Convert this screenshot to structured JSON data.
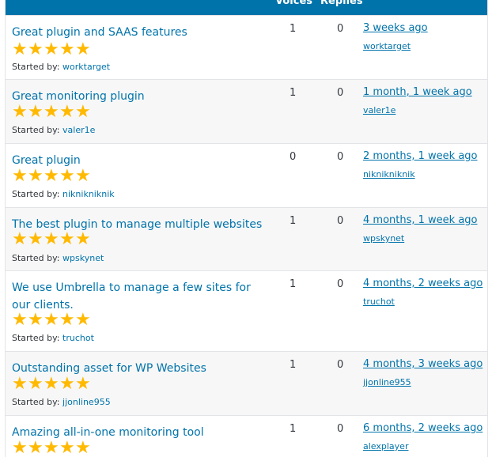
{
  "header": {
    "voices": "Voices",
    "replies": "Replies"
  },
  "rating_color": "#ffb900",
  "link_color": "#0073aa",
  "header_color": "#0073aa",
  "topics": [
    {
      "title": "Great plugin and SAAS features",
      "rating": 5,
      "started_label": "Started by:",
      "author": "worktarget",
      "voices": "1",
      "replies": "0",
      "freshness": "3 weeks ago",
      "last_user": "worktarget"
    },
    {
      "title": "Great monitoring plugin",
      "rating": 5,
      "started_label": "Started by:",
      "author": "valer1e",
      "voices": "1",
      "replies": "0",
      "freshness": "1 month, 1 week ago",
      "last_user": "valer1e"
    },
    {
      "title": "Great plugin",
      "rating": 5,
      "started_label": "Started by:",
      "author": "niknikniknik",
      "voices": "0",
      "replies": "0",
      "freshness": "2 months, 1 week ago",
      "last_user": "niknikniknik"
    },
    {
      "title": "The best plugin to manage multiple websites",
      "rating": 5,
      "started_label": "Started by:",
      "author": "wpskynet",
      "voices": "1",
      "replies": "0",
      "freshness": "4 months, 1 week ago",
      "last_user": "wpskynet"
    },
    {
      "title": "We use Umbrella to manage a few sites for our clients.",
      "rating": 5,
      "started_label": "Started by:",
      "author": "truchot",
      "voices": "1",
      "replies": "0",
      "freshness": "4 months, 2 weeks ago",
      "last_user": "truchot"
    },
    {
      "title": "Outstanding asset for WP Websites",
      "rating": 5,
      "started_label": "Started by:",
      "author": "jjonline955",
      "voices": "1",
      "replies": "0",
      "freshness": "4 months, 3 weeks ago",
      "last_user": "jjonline955"
    },
    {
      "title": "Amazing all-in-one monitoring tool",
      "rating": 5,
      "started_label": "",
      "author": "",
      "voices": "1",
      "replies": "0",
      "freshness": "6 months, 2 weeks ago",
      "last_user": "alexplayer"
    }
  ]
}
